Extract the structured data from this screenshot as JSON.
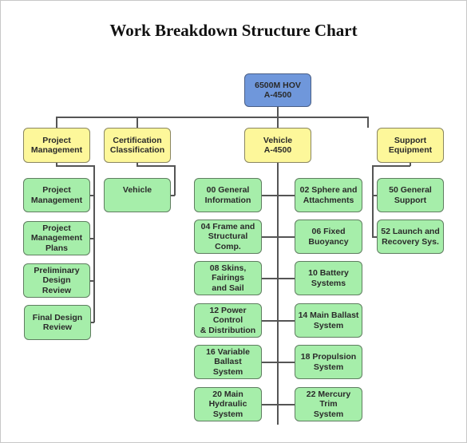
{
  "title": "Work Breakdown Structure Chart",
  "colors": {
    "root": "#6f97db",
    "level1": "#fdf79a",
    "leaf": "#a6eeaa",
    "connector": "#555555"
  },
  "root": {
    "label": "6500M HOV\nA-4500"
  },
  "branches": [
    {
      "label": "Project\nManagement",
      "children": [
        "Project\nManagement",
        "Project\nManagement\nPlans",
        "Preliminary\nDesign\nReview",
        "Final Design\nReview"
      ]
    },
    {
      "label": "Certification\nClassification",
      "children": [
        "Vehicle"
      ]
    },
    {
      "label": "Vehicle\nA-4500",
      "children_left": [
        "00 General\nInformation",
        "04 Frame and\nStructural\nComp.",
        "08 Skins,\nFairings\nand Sail",
        "12 Power\nControl\n& Distribution",
        "16 Variable\nBallast\nSystem",
        "20 Main\nHydraulic\nSystem"
      ],
      "children_right": [
        "02 Sphere and\nAttachments",
        "06 Fixed\nBuoyancy",
        "10 Battery\nSystems",
        "14 Main Ballast\nSystem",
        "18 Propulsion\nSystem",
        "22 Mercury Trim\nSystem"
      ]
    },
    {
      "label": "Support\nEquipment",
      "children": [
        "50 General\nSupport",
        "52 Launch and\nRecovery Sys."
      ]
    }
  ]
}
